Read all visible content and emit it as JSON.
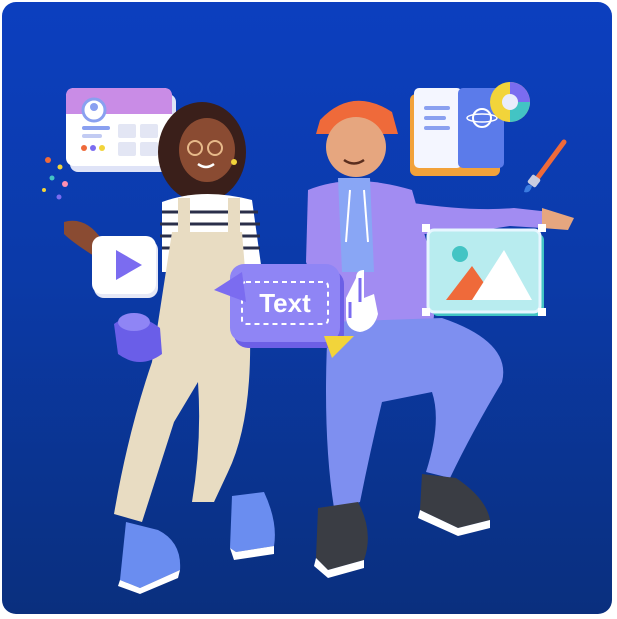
{
  "illustration": {
    "text_card_label": "Text"
  },
  "colors": {
    "background_top": "#0c3fbf",
    "background_bottom": "#0a2f7e",
    "accent_purple": "#7b6cf0",
    "accent_yellow": "#f2d43a",
    "accent_orange": "#ef6a3a",
    "accent_teal": "#43c4c4"
  },
  "icons": [
    "profile-card-icon",
    "play-button-icon",
    "text-box-icon",
    "hand-cursor-icon",
    "image-frame-icon",
    "book-icon",
    "color-wheel-icon",
    "paintbrush-icon",
    "confetti-icon"
  ]
}
